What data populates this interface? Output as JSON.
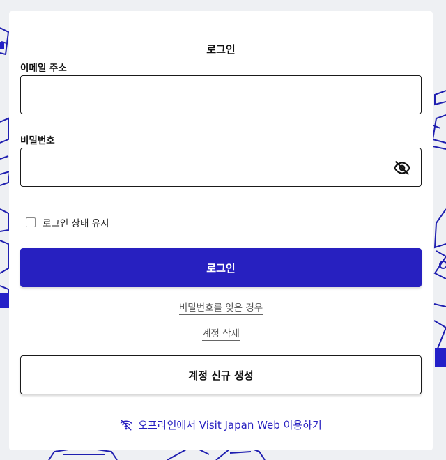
{
  "login_form": {
    "title": "로그인",
    "email_label": "이메일 주소",
    "email_value": "",
    "password_label": "비밀번호",
    "password_value": "",
    "password_toggle_icon": "eye-slash-icon",
    "remember_label": "로그인 상태 유지",
    "remember_checked": false,
    "login_button": "로그인",
    "forgot_password_link": "비밀번호를 잊은 경우",
    "delete_account_link": "계정 삭제",
    "signup_button": "계정 신규 생성",
    "offline_link": "오프라인에서 Visit Japan Web 이용하기",
    "offline_icon": "wifi-off-icon"
  },
  "colors": {
    "primary": "#2720c0",
    "background": "#eef0f3",
    "card": "#ffffff",
    "border": "#1a1a1a"
  }
}
